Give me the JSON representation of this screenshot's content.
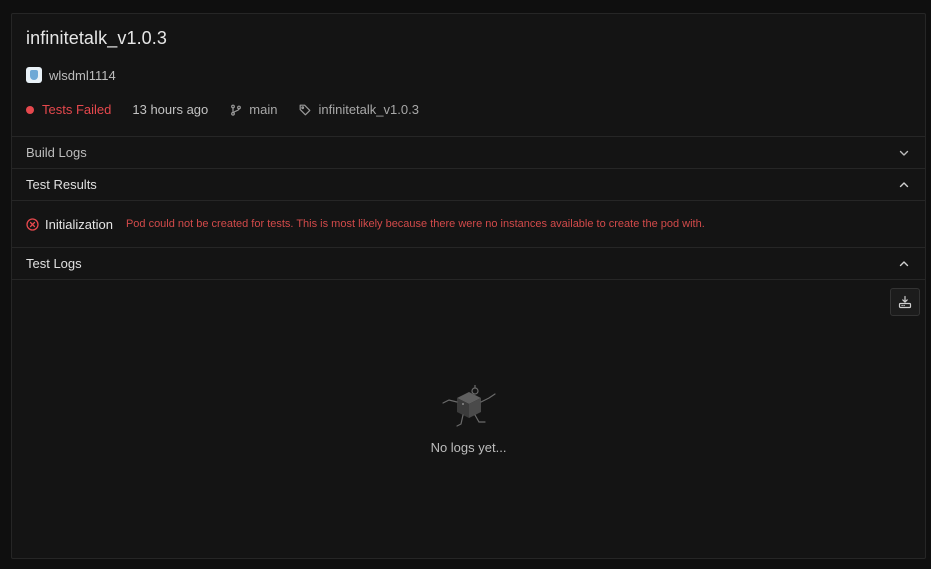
{
  "build": {
    "title": "infinitetalk_v1.0.3",
    "author": "wlsdml1114",
    "status": "Tests Failed",
    "time_ago": "13 hours ago",
    "branch": "main",
    "tag": "infinitetalk_v1.0.3"
  },
  "sections": {
    "build_logs": "Build Logs",
    "test_results": "Test Results",
    "test_logs": "Test Logs"
  },
  "test_results": [
    {
      "name": "Initialization",
      "status": "failed",
      "message": "Pod could not be created for tests. This is most likely because there were no instances available to create the pod with."
    }
  ],
  "logs": {
    "empty_text": "No logs yet..."
  },
  "colors": {
    "error": "#e5484d",
    "background": "#141414",
    "border": "#262626"
  }
}
